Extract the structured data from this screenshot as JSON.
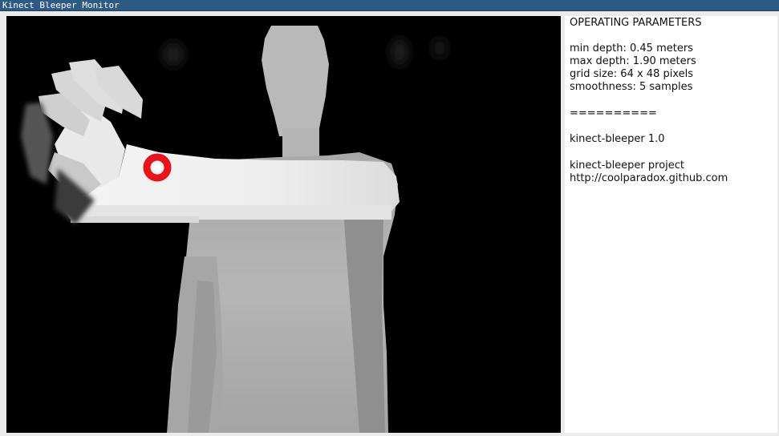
{
  "window": {
    "title": "Kinect Bleeper Monitor"
  },
  "info": {
    "heading": "OPERATING PARAMETERS",
    "min_depth": "min depth: 0.45 meters",
    "max_depth": "max depth: 1.90 meters",
    "grid_size": "grid size: 64 x 48 pixels",
    "smoothness": "smoothness: 5 samples",
    "separator": "==========",
    "version": "kinect-bleeper 1.0",
    "project": "kinect-bleeper project",
    "url": "http://coolparadox.github.com"
  },
  "colors": {
    "title_bar": "#2c5a83",
    "tracking_marker": "#e8141c"
  }
}
